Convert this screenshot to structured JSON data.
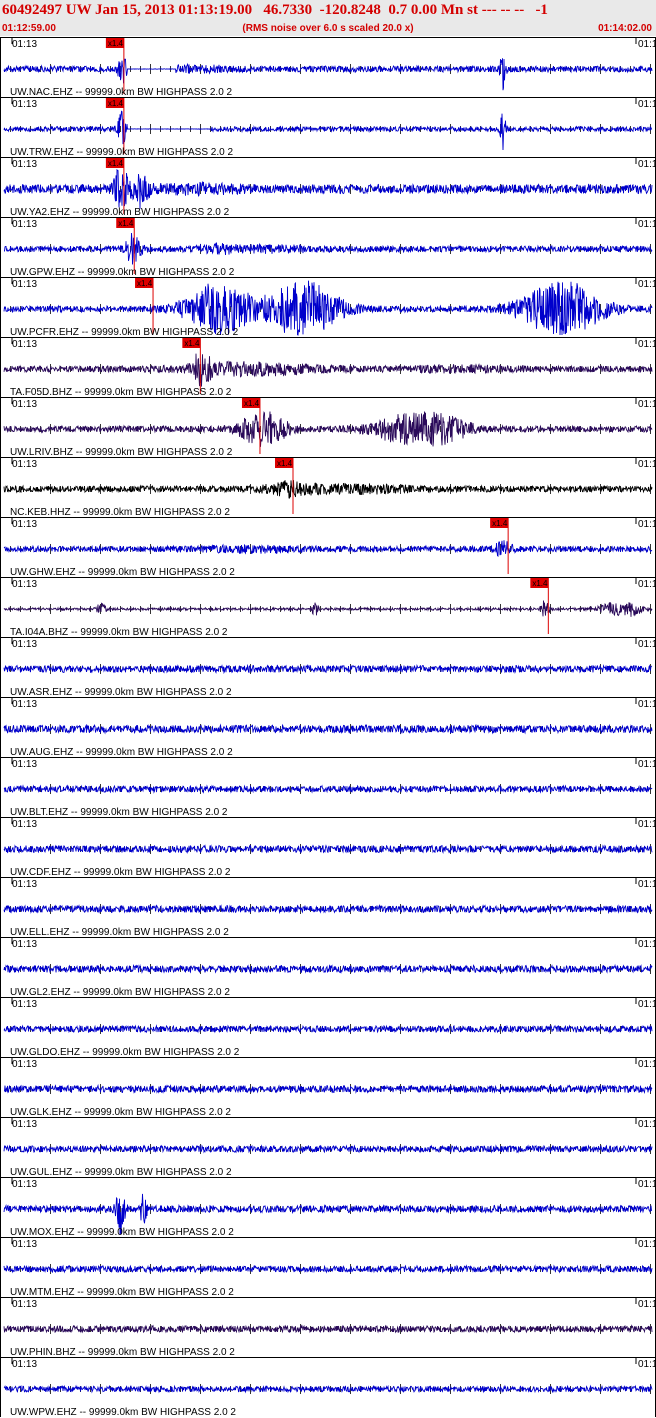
{
  "header": {
    "title": "60492497 UW Jan 15, 2013 01:13:19.00   46.7330  -120.8248  0.7 0.00 Mn st --- -- --   -1",
    "start_time": "01:12:59.00",
    "note": "(RMS noise over 6.0 s scaled 20.0 x)",
    "end_time": "01:14:02.00"
  },
  "colors": {
    "blue": "#0000cc",
    "purple": "#2a0a5a",
    "black": "#000000",
    "pick": "#dd0000",
    "header_text": "#d40000",
    "header_bg": "#e9e9e9"
  },
  "chart_data": {
    "type": "line",
    "title": "60492497 UW Jan 15, 2013 01:13:19.00   46.7330  -120.8248  0.7 0.00 Mn st --- -- --   -1",
    "x_range": [
      "01:12:59.00",
      "01:14:02.00"
    ],
    "tick_label": "01:13",
    "pick_label": "x1.4",
    "series": [
      {
        "name": "UW.NAC.EHZ -- 99999.0km BW  HIGHPASS  2.0  2",
        "color": "blue",
        "pick_frac": 0.185,
        "profile": "nac",
        "amp": 1.0
      },
      {
        "name": "UW.TRW.EHZ -- 99999.0km BW  HIGHPASS  2.0  2",
        "color": "blue",
        "pick_frac": 0.185,
        "profile": "trw",
        "amp": 1.0
      },
      {
        "name": "UW.YA2.EHZ -- 99999.0km BW  HIGHPASS  2.0  2",
        "color": "blue",
        "pick_frac": 0.185,
        "profile": "ya2",
        "amp": 1.3
      },
      {
        "name": "UW.GPW.EHZ -- 99999.0km BW  HIGHPASS  2.0  2",
        "color": "blue",
        "pick_frac": 0.201,
        "profile": "gpw",
        "amp": 1.0
      },
      {
        "name": "UW.PCFR.EHZ -- 99999.0km BW  HIGHPASS  2.0  2",
        "color": "blue",
        "pick_frac": 0.23,
        "profile": "pcfr",
        "amp": 1.0
      },
      {
        "name": "TA.F05D.BHZ -- 99999.0km BW  HIGHPASS  2.0  2",
        "color": "purple",
        "pick_frac": 0.303,
        "profile": "f05d",
        "amp": 1.0
      },
      {
        "name": "UW.LRIV.BHZ -- 99999.0km BW  HIGHPASS  2.0  2",
        "color": "purple",
        "pick_frac": 0.395,
        "profile": "lriv",
        "amp": 1.0
      },
      {
        "name": "NC.KEB.HHZ -- 99999.0km BW  HIGHPASS  2.0  2",
        "color": "black",
        "pick_frac": 0.446,
        "profile": "keb",
        "amp": 1.0
      },
      {
        "name": "UW.GHW.EHZ -- 99999.0km BW  HIGHPASS  2.0  2",
        "color": "blue",
        "pick_frac": 0.778,
        "profile": "ghw",
        "amp": 1.0
      },
      {
        "name": "TA.I04A.BHZ -- 99999.0km BW  HIGHPASS  2.0  2",
        "color": "purple",
        "pick_frac": 0.84,
        "profile": "i04a",
        "amp": 1.0
      },
      {
        "name": "UW.ASR.EHZ -- 99999.0km BW  HIGHPASS  2.0  2",
        "color": "blue",
        "pick_frac": null,
        "profile": "noise",
        "amp": 1.0
      },
      {
        "name": "UW.AUG.EHZ -- 99999.0km BW  HIGHPASS  2.0  2",
        "color": "blue",
        "pick_frac": null,
        "profile": "noise",
        "amp": 1.1
      },
      {
        "name": "UW.BLT.EHZ -- 99999.0km BW  HIGHPASS  2.0  2",
        "color": "blue",
        "pick_frac": null,
        "profile": "noise",
        "amp": 0.9
      },
      {
        "name": "UW.CDF.EHZ -- 99999.0km BW  HIGHPASS  2.0  2",
        "color": "blue",
        "pick_frac": null,
        "profile": "noise",
        "amp": 1.0
      },
      {
        "name": "UW.ELL.EHZ -- 99999.0km BW  HIGHPASS  2.0  2",
        "color": "blue",
        "pick_frac": null,
        "profile": "noise",
        "amp": 1.0
      },
      {
        "name": "UW.GL2.EHZ -- 99999.0km BW  HIGHPASS  2.0  2",
        "color": "blue",
        "pick_frac": null,
        "profile": "noise",
        "amp": 1.0
      },
      {
        "name": "UW.GLDO.EHZ -- 99999.0km BW  HIGHPASS  2.0  2",
        "color": "blue",
        "pick_frac": null,
        "profile": "noise",
        "amp": 0.9
      },
      {
        "name": "UW.GLK.EHZ -- 99999.0km BW  HIGHPASS  2.0  2",
        "color": "blue",
        "pick_frac": null,
        "profile": "noise",
        "amp": 1.0
      },
      {
        "name": "UW.GUL.EHZ -- 99999.0km BW  HIGHPASS  2.0  2",
        "color": "blue",
        "pick_frac": null,
        "profile": "noise",
        "amp": 0.9
      },
      {
        "name": "UW.MOX.EHZ -- 99999.0km BW  HIGHPASS  2.0  2",
        "color": "blue",
        "pick_frac": null,
        "profile": "mox",
        "amp": 1.0
      },
      {
        "name": "UW.MTM.EHZ -- 99999.0km BW  HIGHPASS  2.0  2",
        "color": "blue",
        "pick_frac": null,
        "profile": "noise",
        "amp": 0.9
      },
      {
        "name": "UW.PHIN.BHZ -- 99999.0km BW  HIGHPASS  2.0  2",
        "color": "purple",
        "pick_frac": null,
        "profile": "noise",
        "amp": 0.9
      },
      {
        "name": "UW.WPW.EHZ -- 99999.0km BW  HIGHPASS  2.0  2",
        "color": "blue",
        "pick_frac": null,
        "profile": "noise",
        "amp": 0.8
      }
    ]
  }
}
